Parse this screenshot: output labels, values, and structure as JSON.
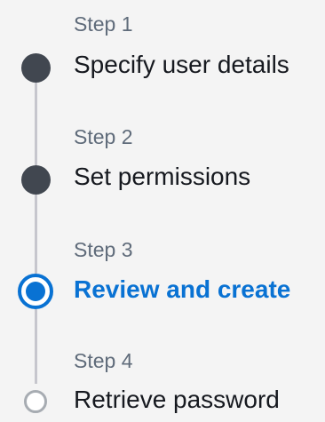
{
  "wizard": {
    "steps": [
      {
        "step_number": "Step 1",
        "title": "Specify user details",
        "status": "completed"
      },
      {
        "step_number": "Step 2",
        "title": "Set permissions",
        "status": "completed"
      },
      {
        "step_number": "Step 3",
        "title": "Review and create",
        "status": "current"
      },
      {
        "step_number": "Step 4",
        "title": "Retrieve password",
        "status": "upcoming"
      }
    ]
  },
  "colors": {
    "completed": "#414750",
    "current": "#0972d3",
    "upcoming": "#a7acb2",
    "connector": "#c6c6cd",
    "label_muted": "#5f6b7a",
    "text": "#16191f"
  }
}
